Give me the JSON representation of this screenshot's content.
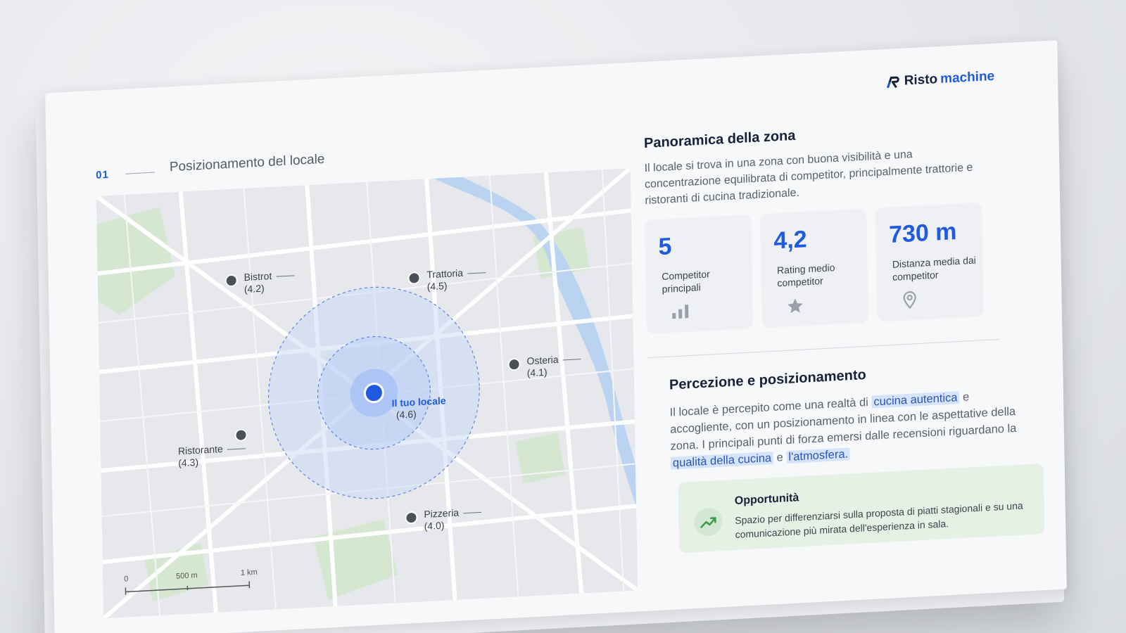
{
  "section": {
    "number": "01",
    "title": "Posizionamento del locale"
  },
  "brand": {
    "prefix": "Risto",
    "suffix": "machine"
  },
  "map": {
    "you": {
      "label": "Il tuo locale",
      "rating": "(4.6)"
    },
    "competitors": [
      {
        "name": "Bistrot",
        "rating": "(4.2)"
      },
      {
        "name": "Trattoria",
        "rating": "(4.5)"
      },
      {
        "name": "Osteria",
        "rating": "(4.1)"
      },
      {
        "name": "Ristorante",
        "rating": "(4.3)"
      },
      {
        "name": "Pizzeria",
        "rating": "(4.0)"
      }
    ],
    "scale": {
      "zero": "0",
      "mid": "500 m",
      "max": "1 km"
    }
  },
  "overview": {
    "title": "Panoramica della zona",
    "text": "Il locale si trova in una zona con buona visibilità e una concentrazione equilibrata di competitor, principalmente trattorie e ristoranti di cucina tradizionale."
  },
  "stats": [
    {
      "value": "5",
      "label": "Competitor principali",
      "icon": "bar-chart-icon"
    },
    {
      "value": "4,2",
      "label": "Rating medio competitor",
      "icon": "star-icon"
    },
    {
      "value": "730 m",
      "label": "Distanza media dai competitor",
      "icon": "location-pin-icon"
    }
  ],
  "perception": {
    "title": "Percezione e posizionamento",
    "t1": "Il locale è percepito come una realtà di ",
    "h1": "cucina autentica",
    "t2": " e accogliente, con un posizionamento in linea con le aspettative della zona. I principali punti di forza emersi dalle recensioni riguardano la ",
    "h2": "qualità della cucina",
    "t3": " e ",
    "h3": "l'atmosfera.",
    "highlight_color": "#d6e4fb"
  },
  "opportunity": {
    "title": "Opportunità",
    "text": "Spazio per differenziarsi sulla proposta di piatti stagionali e su una comunicazione più mirata dell'esperienza in sala.",
    "icon": "trending-up-icon"
  },
  "colors": {
    "accent": "#1f5ae0",
    "river": "#b9d3f0",
    "park": "#d5e6d1",
    "opportunity_bg": "#e5f1e5"
  }
}
